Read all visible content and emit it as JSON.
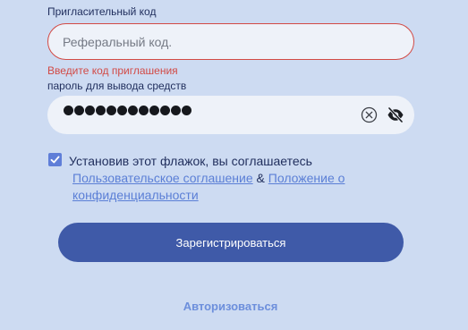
{
  "colors": {
    "background": "#cddbf2",
    "error": "#d24a45",
    "accent": "#5f7ed8",
    "link": "#5b7fd6",
    "primary_button": "#3f5aa8",
    "login_link": "#6d8fdc"
  },
  "referral": {
    "label": "Пригласительный код",
    "placeholder": "Реферальный код.",
    "value": "",
    "error": "Введите код приглашения"
  },
  "withdraw_password": {
    "label": "пароль для вывода средств",
    "masked_length": 12,
    "clear_icon": "clear-circle-icon",
    "visibility_icon": "eye-off-icon"
  },
  "agreement": {
    "checked": true,
    "check_icon": "checkmark-icon",
    "text": "Установив этот флажок, вы соглашаетесь",
    "user_agreement_link": "Пользовательское соглашение",
    "and": "&",
    "privacy_link_line1": "Положение о",
    "privacy_link_line2": "конфиденциальности"
  },
  "register_button": "Зарегистрироваться",
  "login_link": "Авторизоваться"
}
